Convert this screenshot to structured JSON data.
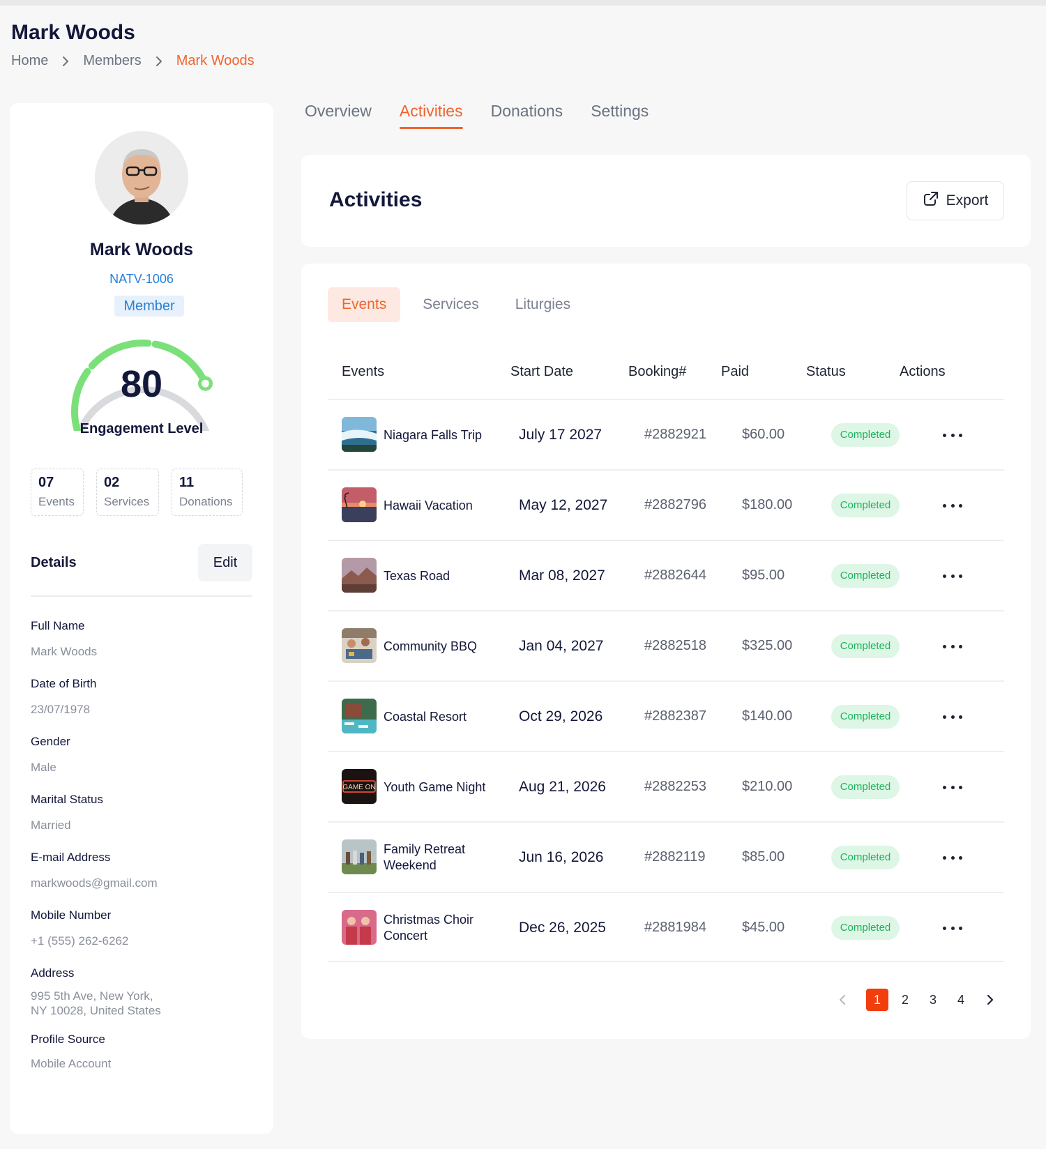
{
  "header": {
    "title": "Mark Woods",
    "breadcrumb": [
      "Home",
      "Members",
      "Mark Woods"
    ]
  },
  "profile": {
    "name": "Mark Woods",
    "id": "NATV-1006",
    "role": "Member",
    "engagement_score": "80",
    "engagement_score_fraction": 0.8,
    "engagement_label": "Engagement Level",
    "stats": [
      {
        "value": "07",
        "label": "Events"
      },
      {
        "value": "02",
        "label": "Services"
      },
      {
        "value": "11",
        "label": "Donations"
      }
    ],
    "details_title": "Details",
    "edit_label": "Edit",
    "details": [
      {
        "label": "Full Name",
        "value": "Mark Woods"
      },
      {
        "label": "Date of Birth",
        "value": "23/07/1978"
      },
      {
        "label": "Gender",
        "value": "Male"
      },
      {
        "label": "Marital Status",
        "value": "Married"
      },
      {
        "label": "E-mail Address",
        "value": "markwoods@gmail.com"
      },
      {
        "label": "Mobile Number",
        "value": "+1 (555) 262-6262"
      },
      {
        "label": "Address",
        "value_line1": "995 5th Ave, New York,",
        "value_line2": "NY 10028, United States"
      },
      {
        "label": "Profile Source",
        "value": "Mobile Account"
      }
    ]
  },
  "tabs": [
    "Overview",
    "Activities",
    "Donations",
    "Settings"
  ],
  "activities": {
    "title": "Activities",
    "export_label": "Export",
    "subtabs": [
      "Events",
      "Services",
      "Liturgies"
    ],
    "columns": [
      "Events",
      "Start Date",
      "Booking#",
      "Paid",
      "Status",
      "Actions"
    ],
    "rows": [
      {
        "name": "Niagara Falls Trip",
        "date": "July 17 2027",
        "booking": "#2882921",
        "paid": "$60.00",
        "status": "Completed"
      },
      {
        "name": "Hawaii Vacation",
        "date": "May 12, 2027",
        "booking": "#2882796",
        "paid": "$180.00",
        "status": "Completed"
      },
      {
        "name": "Texas Road",
        "date": "Mar 08, 2027",
        "booking": "#2882644",
        "paid": "$95.00",
        "status": "Completed"
      },
      {
        "name": "Community BBQ",
        "date": "Jan 04, 2027",
        "booking": "#2882518",
        "paid": "$325.00",
        "status": "Completed"
      },
      {
        "name": "Coastal Resort",
        "date": "Oct 29, 2026",
        "booking": "#2882387",
        "paid": "$140.00",
        "status": "Completed"
      },
      {
        "name": "Youth Game Night",
        "date": "Aug 21, 2026",
        "booking": "#2882253",
        "paid": "$210.00",
        "status": "Completed",
        "thumb_text": "GAME ON"
      },
      {
        "name": "Family Retreat Weekend",
        "date": "Jun 16, 2026",
        "booking": "#2882119",
        "paid": "$85.00",
        "status": "Completed"
      },
      {
        "name": "Christmas Choir Concert",
        "date": "Dec 26, 2025",
        "booking": "#2881984",
        "paid": "$45.00",
        "status": "Completed"
      }
    ],
    "pagination": [
      "1",
      "2",
      "3",
      "4"
    ],
    "current_page": "1"
  },
  "colors": {
    "accent": "#f0642d",
    "page_active": "#f23d0c",
    "link_blue": "#2a7fd4",
    "success": "#1db35a",
    "gauge_green": "#7be07a",
    "gauge_track": "#d9dadd"
  }
}
